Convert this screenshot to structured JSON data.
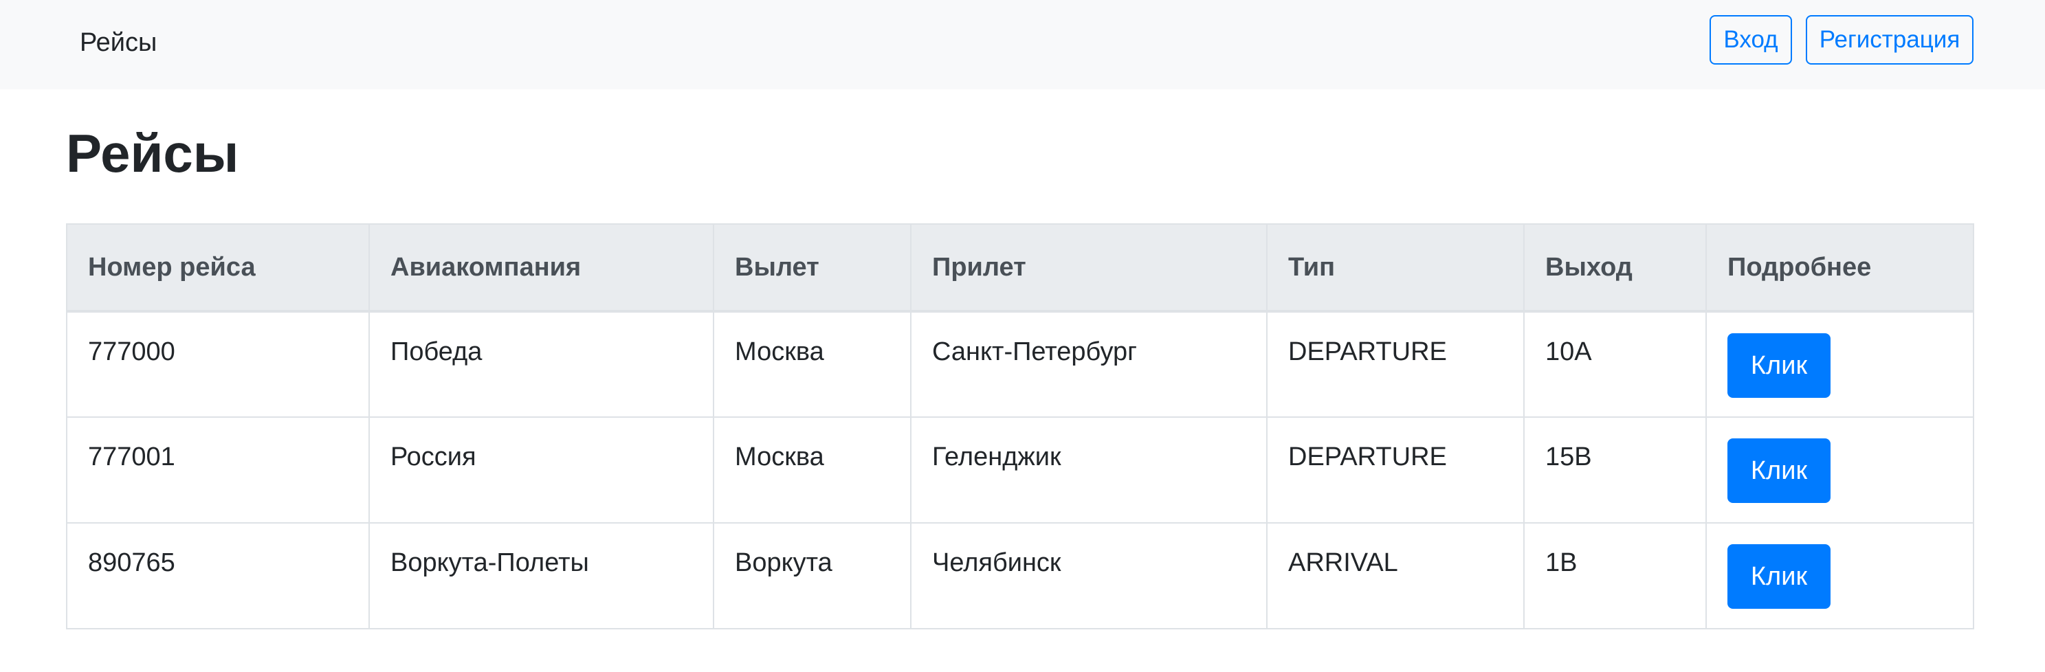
{
  "navbar": {
    "brand": "Рейсы",
    "login_label": "Вход",
    "register_label": "Регистрация"
  },
  "page": {
    "title": "Рейсы"
  },
  "table": {
    "headers": [
      "Номер рейса",
      "Авиакомпания",
      "Вылет",
      "Прилет",
      "Тип",
      "Выход",
      "Подробнее"
    ],
    "rows": [
      {
        "flight": "777000",
        "airline": "Победа",
        "from": "Москва",
        "to": "Санкт-Петербург",
        "type": "DEPARTURE",
        "gate": "10A",
        "button": "Клик"
      },
      {
        "flight": "777001",
        "airline": "Россия",
        "from": "Москва",
        "to": "Геленджик",
        "type": "DEPARTURE",
        "gate": "15B",
        "button": "Клик"
      },
      {
        "flight": "890765",
        "airline": "Воркута-Полеты",
        "from": "Воркута",
        "to": "Челябинск",
        "type": "ARRIVAL",
        "gate": "1B",
        "button": "Клик"
      }
    ]
  },
  "colors": {
    "primary": "#007bff",
    "navbar_bg": "#f8f9fa",
    "header_bg": "#e9ecef",
    "border": "#dee2e6"
  }
}
